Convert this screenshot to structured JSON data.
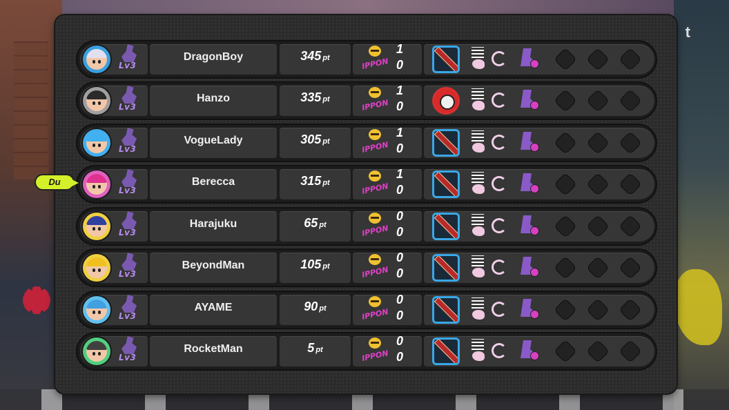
{
  "you_marker": "Du",
  "corner_glyph": "t",
  "rank_label": "Lv3",
  "ippon_label": "IPPON",
  "points_unit": "pt",
  "players": [
    {
      "name": "DragonBoy",
      "points": "345",
      "top_score": "1",
      "bottom_score": "0",
      "weapon": "sword",
      "avatar_color": "#3aa0e0",
      "hair_color": "#e0e0f0"
    },
    {
      "name": "Hanzo",
      "points": "335",
      "top_score": "1",
      "bottom_score": "0",
      "weapon": "disc",
      "avatar_color": "#a0a0a0",
      "hair_color": "#2a2a2a"
    },
    {
      "name": "VogueLady",
      "points": "305",
      "top_score": "1",
      "bottom_score": "0",
      "weapon": "sword",
      "avatar_color": "#40b0f0",
      "hair_color": "#40b0f0"
    },
    {
      "name": "Berecca",
      "points": "315",
      "top_score": "1",
      "bottom_score": "0",
      "weapon": "sword",
      "avatar_color": "#e060c0",
      "hair_color": "#e03090"
    },
    {
      "name": "Harajuku",
      "points": "65",
      "top_score": "0",
      "bottom_score": "0",
      "weapon": "sword",
      "avatar_color": "#f0d040",
      "hair_color": "#3040a0"
    },
    {
      "name": "BeyondMan",
      "points": "105",
      "top_score": "0",
      "bottom_score": "0",
      "weapon": "sword",
      "avatar_color": "#f0d040",
      "hair_color": "#f0c020"
    },
    {
      "name": "AYAME",
      "points": "90",
      "top_score": "0",
      "bottom_score": "0",
      "weapon": "sword",
      "avatar_color": "#60c0f0",
      "hair_color": "#40a0e0"
    },
    {
      "name": "RocketMan",
      "points": "5",
      "top_score": "0",
      "bottom_score": "0",
      "weapon": "sword",
      "avatar_color": "#50d080",
      "hair_color": "#404040"
    }
  ]
}
